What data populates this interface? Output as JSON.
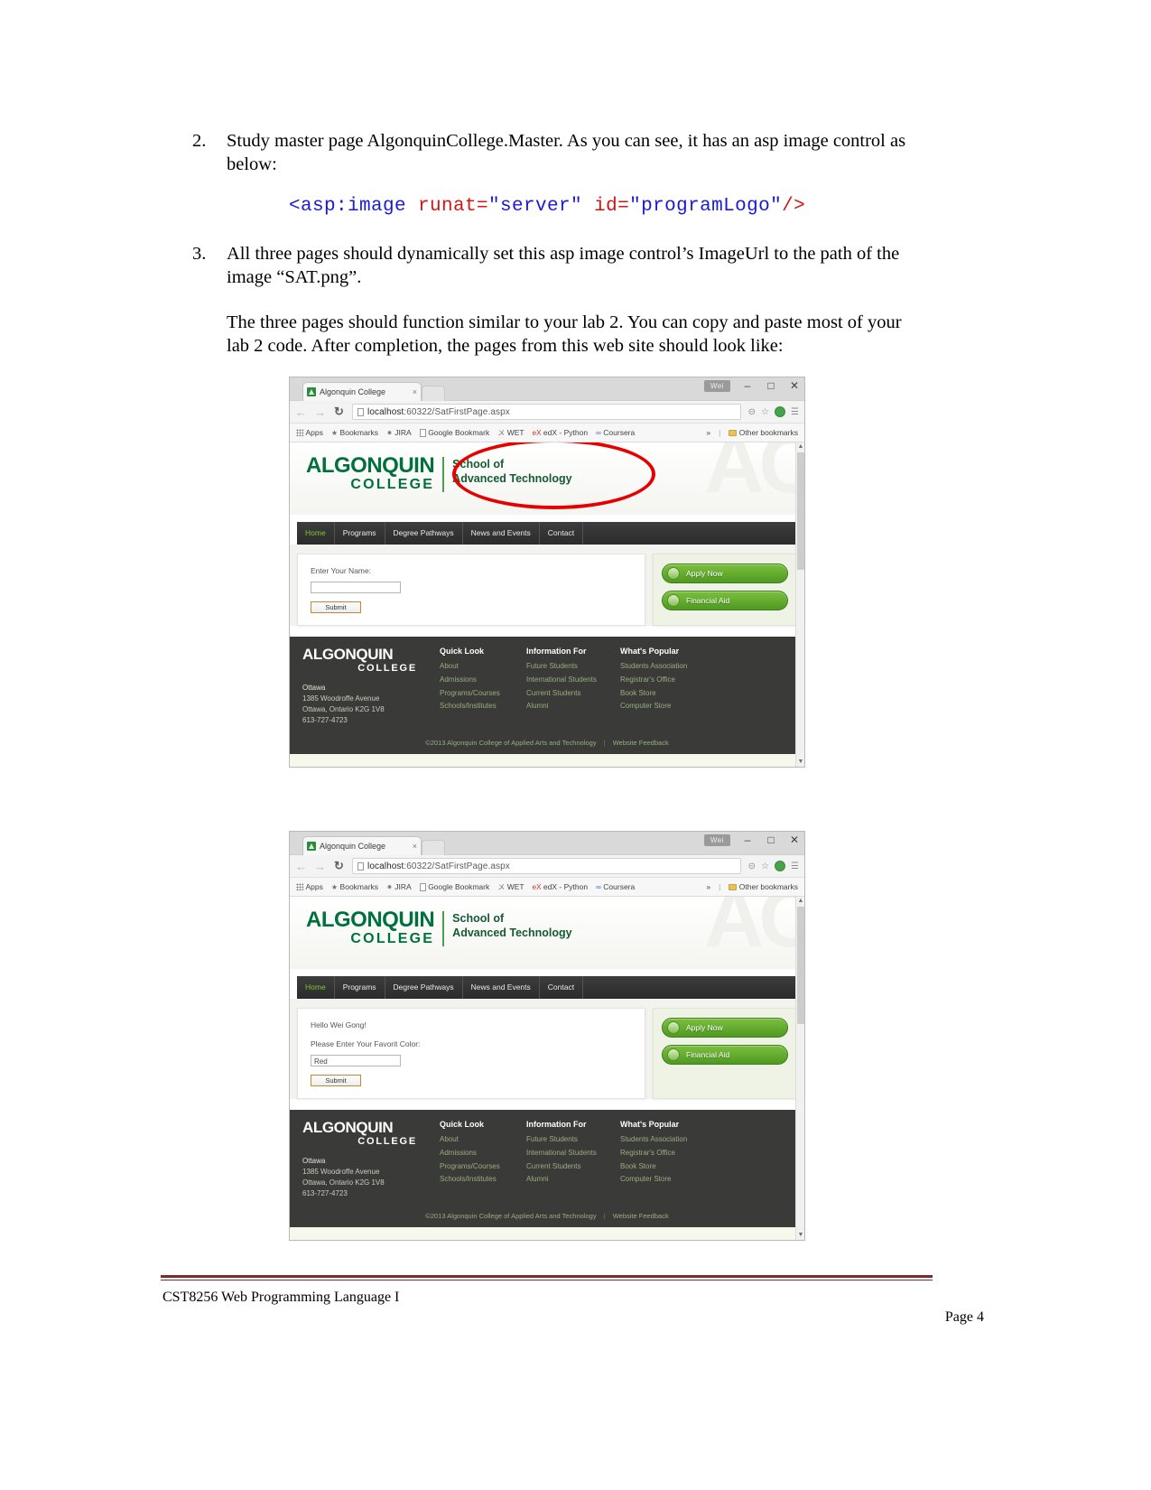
{
  "document": {
    "item2": {
      "number": "2.",
      "text": "Study master page AlgonquinCollege.Master. As you can see, it has an asp image control as below:"
    },
    "code": {
      "open_tag": "<asp:image ",
      "attr1_name": "runat=",
      "attr1_value": "\"server\"",
      "space": " ",
      "attr2_name": "id=",
      "attr2_value": "\"programLogo\"",
      "close_tag": "/>"
    },
    "item3": {
      "number": "3.",
      "text": "All three pages should dynamically set this asp image control’s ImageUrl to the path of the image “SAT.png”."
    },
    "paragraph": "The three pages should function similar to your lab 2. You can copy and paste most of your lab 2 code. After completion, the pages from this web site should look like:"
  },
  "browser": {
    "tab_title": "Algonquin College",
    "tab_close": "×",
    "user_badge": "Wei",
    "minimize": "–",
    "maximize": "□",
    "close": "✕",
    "back": "←",
    "forward": "→",
    "reload": "↻",
    "url_host": "localhost",
    "url_path": ":60322/SatFirstPage.aspx",
    "zoom_icon": "⊝",
    "star_icon": "☆",
    "menu_icon": "☰",
    "bookmarks": [
      {
        "label": "Apps",
        "icon": "grid-icon"
      },
      {
        "label": "Bookmarks",
        "icon": "star-icon"
      },
      {
        "label": "JIRA",
        "icon": "jira-icon"
      },
      {
        "label": "Google Bookmark",
        "icon": "page-icon"
      },
      {
        "label": "WET",
        "icon": "wet-icon"
      },
      {
        "label": "edX - Python",
        "icon": "edx-icon"
      },
      {
        "label": "Coursera",
        "icon": "coursera-icon"
      }
    ],
    "overflow": "»",
    "other_bookmarks": "Other bookmarks"
  },
  "site": {
    "logo": {
      "main": "ALGONQUIN",
      "sub": "COLLEGE",
      "school_line1": "School of",
      "school_line2": "Advanced Technology",
      "watermark": "AC"
    },
    "nav": [
      {
        "label": "Home",
        "active": true
      },
      {
        "label": "Programs",
        "active": false
      },
      {
        "label": "Degree Pathways",
        "active": false
      },
      {
        "label": "News and Events",
        "active": false
      },
      {
        "label": "Contact",
        "active": false
      }
    ],
    "cta": [
      {
        "label": "Apply Now"
      },
      {
        "label": "Financial Aid"
      }
    ],
    "footer": {
      "logo_main": "ALGONQUIN",
      "logo_sub": "COLLEGE",
      "city": "Ottawa",
      "address1": "1385 Woodroffe Avenue",
      "address2": "Ottawa, Ontario K2G 1V8",
      "phone": "613-727-4723",
      "columns": [
        {
          "heading": "Quick Look",
          "links": [
            "About",
            "Admissions",
            "Programs/Courses",
            "Schools/Institutes"
          ]
        },
        {
          "heading": "Information For",
          "links": [
            "Future Students",
            "International Students",
            "Current Students",
            "Alumni"
          ]
        },
        {
          "heading": "What's Popular",
          "links": [
            "Students Association",
            "Registrar's Office",
            "Book Store",
            "Computer Store"
          ]
        }
      ],
      "copyright": "©2013 Algonquin College of Applied Arts and Technology",
      "feedback": "Website Feedback",
      "separator": "|"
    }
  },
  "screenshot_one": {
    "form_label": "Enter Your Name:",
    "input_value": "",
    "submit_label": "Submit"
  },
  "screenshot_two": {
    "greeting": "Hello Wei Gong!",
    "form_label": "Please Enter Your Favorit Color:",
    "input_value": "Red",
    "submit_label": "Submit"
  },
  "page_footer": {
    "course": "CST8256 Web Programming Language I",
    "page": "Page 4"
  },
  "colors": {
    "brand_green": "#00703c",
    "nav_active": "#86c232",
    "annotation_red": "#e60000",
    "footer_dark": "#3a3a38",
    "rule_maroon": "#7b2b2b",
    "code_blue": "#1a1ad6",
    "code_red": "#d41414"
  }
}
